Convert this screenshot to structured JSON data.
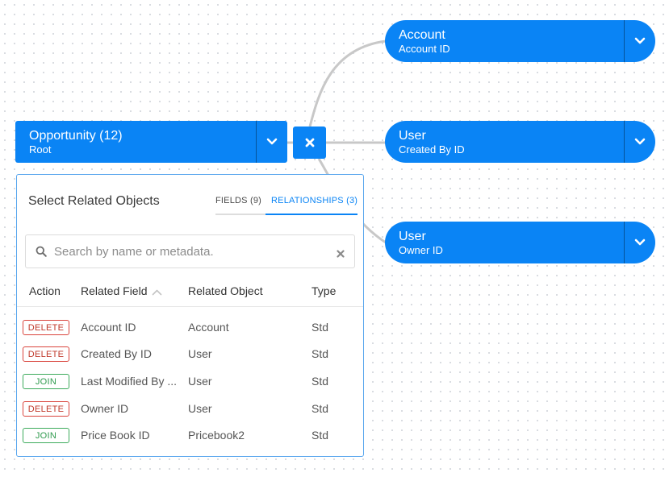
{
  "root_node": {
    "title": "Opportunity (12)",
    "subtitle": "Root"
  },
  "related_nodes": [
    {
      "title": "Account",
      "subtitle": "Account ID"
    },
    {
      "title": "User",
      "subtitle": "Created By ID"
    },
    {
      "title": "User",
      "subtitle": "Owner ID"
    }
  ],
  "icons": {
    "chevron": "chevron-down-icon",
    "remove": "close-icon",
    "search": "search-icon",
    "clear": "close-icon",
    "sort": "sort-ascending-icon"
  },
  "colors": {
    "node_blue": "#0a84f5",
    "panel_border": "#5aa7ee",
    "delete_red": "#d9443c",
    "join_green": "#3dab5c",
    "connector_gray": "#c8c8c8"
  },
  "panel": {
    "title": "Select Related Objects",
    "tabs": [
      {
        "label": "FIELDS (9)",
        "active": false
      },
      {
        "label": "RELATIONSHIPS (3)",
        "active": true
      }
    ],
    "search_placeholder": "Search by name or metadata.",
    "search_value": "",
    "columns": [
      "Action",
      "Related Field",
      "Related Object",
      "Type"
    ],
    "rows": [
      {
        "action": "DELETE",
        "field": "Account ID",
        "object": "Account",
        "type": "Std"
      },
      {
        "action": "DELETE",
        "field": "Created By ID",
        "object": "User",
        "type": "Std"
      },
      {
        "action": "JOIN",
        "field": "Last Modified By ...",
        "object": "User",
        "type": "Std"
      },
      {
        "action": "DELETE",
        "field": "Owner ID",
        "object": "User",
        "type": "Std"
      },
      {
        "action": "JOIN",
        "field": "Price Book ID",
        "object": "Pricebook2",
        "type": "Std"
      }
    ]
  }
}
